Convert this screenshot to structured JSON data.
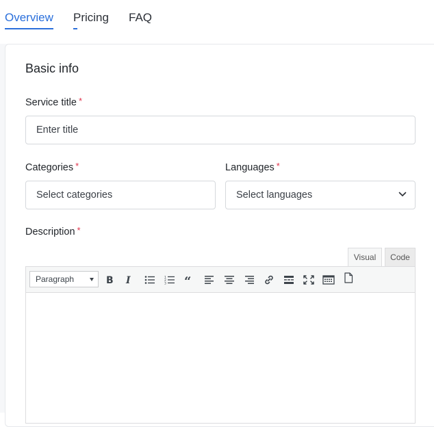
{
  "tabs": [
    {
      "label": "Overview",
      "active": true
    },
    {
      "label": "Pricing",
      "active": false
    },
    {
      "label": "FAQ",
      "active": false
    }
  ],
  "section_title": "Basic info",
  "fields": {
    "service_title": {
      "label": "Service title",
      "required_mark": "*",
      "placeholder": "Enter title"
    },
    "categories": {
      "label": "Categories",
      "required_mark": "*",
      "placeholder": "Select categories"
    },
    "languages": {
      "label": "Languages",
      "required_mark": "*",
      "placeholder": "Select languages"
    },
    "description": {
      "label": "Description",
      "required_mark": "*"
    }
  },
  "editor": {
    "tabs": {
      "visual": "Visual",
      "code": "Code"
    },
    "format_select": "Paragraph",
    "toolbar_icons": [
      "bold-icon",
      "italic-icon",
      "bullet-list-icon",
      "numbered-list-icon",
      "blockquote-icon",
      "align-left-icon",
      "align-center-icon",
      "align-right-icon",
      "link-icon",
      "read-more-icon",
      "fullscreen-icon",
      "toolbar-toggle-icon",
      "page-icon"
    ]
  },
  "colors": {
    "accent": "#2a6fdb",
    "required": "#e0334b"
  }
}
